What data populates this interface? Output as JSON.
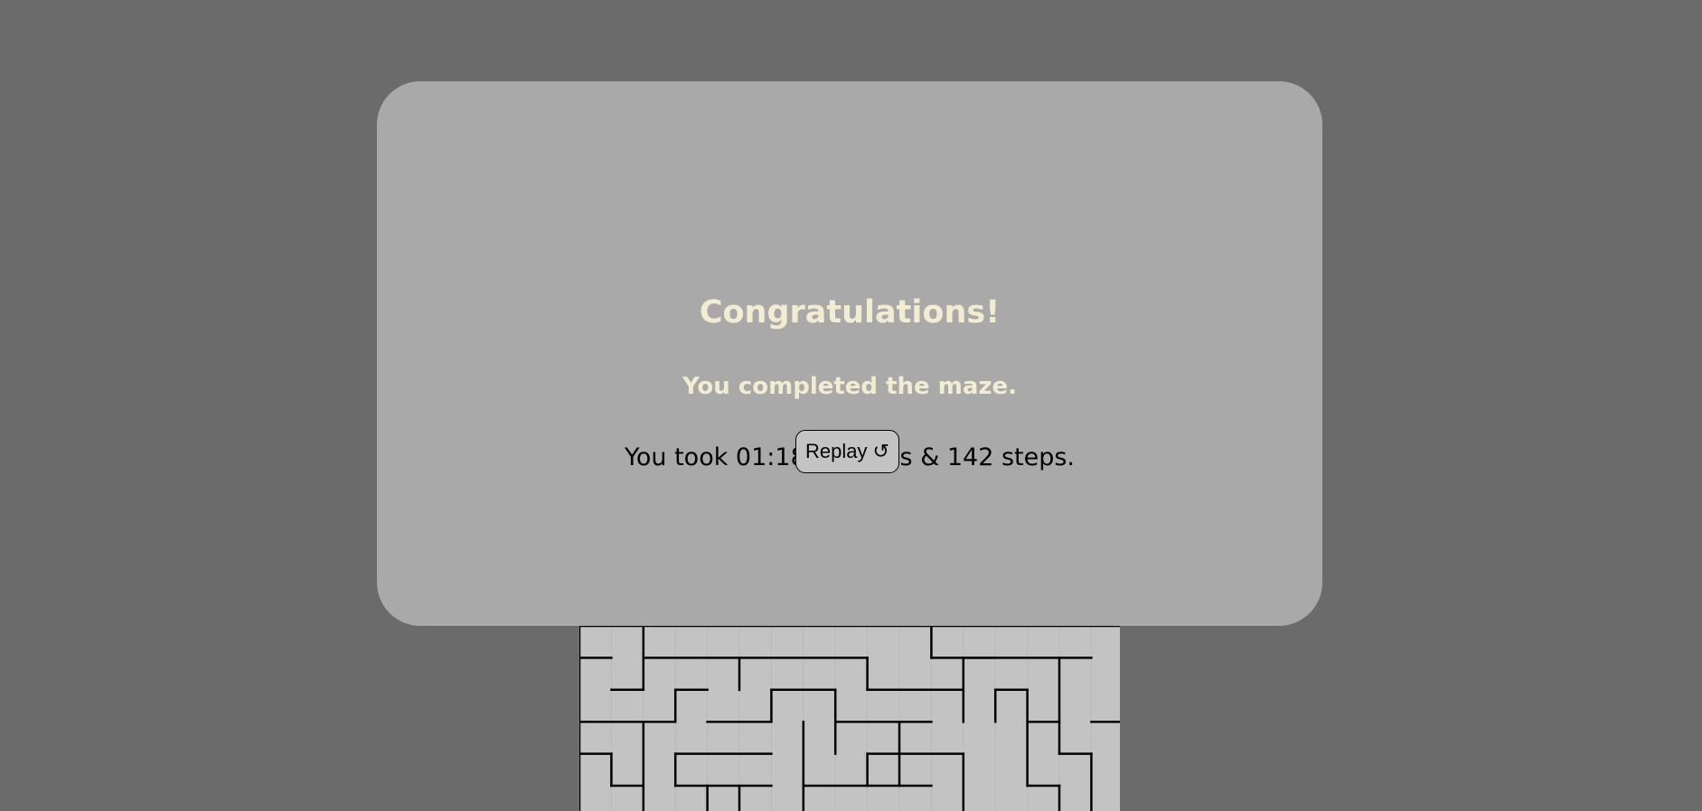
{
  "modal": {
    "title": "Congratulations!",
    "subtitle": "You completed the maze.",
    "stats": "You took 01:18 minutes & 142 steps.",
    "replay_label": "Replay",
    "replay_icon": "↺"
  },
  "colors": {
    "page_background": "#6b6b6b",
    "modal_background": "#a9a9a9",
    "heading_text": "#f2ecd2",
    "maze_floor": "#c3c3c3",
    "maze_wall": "#000000"
  }
}
